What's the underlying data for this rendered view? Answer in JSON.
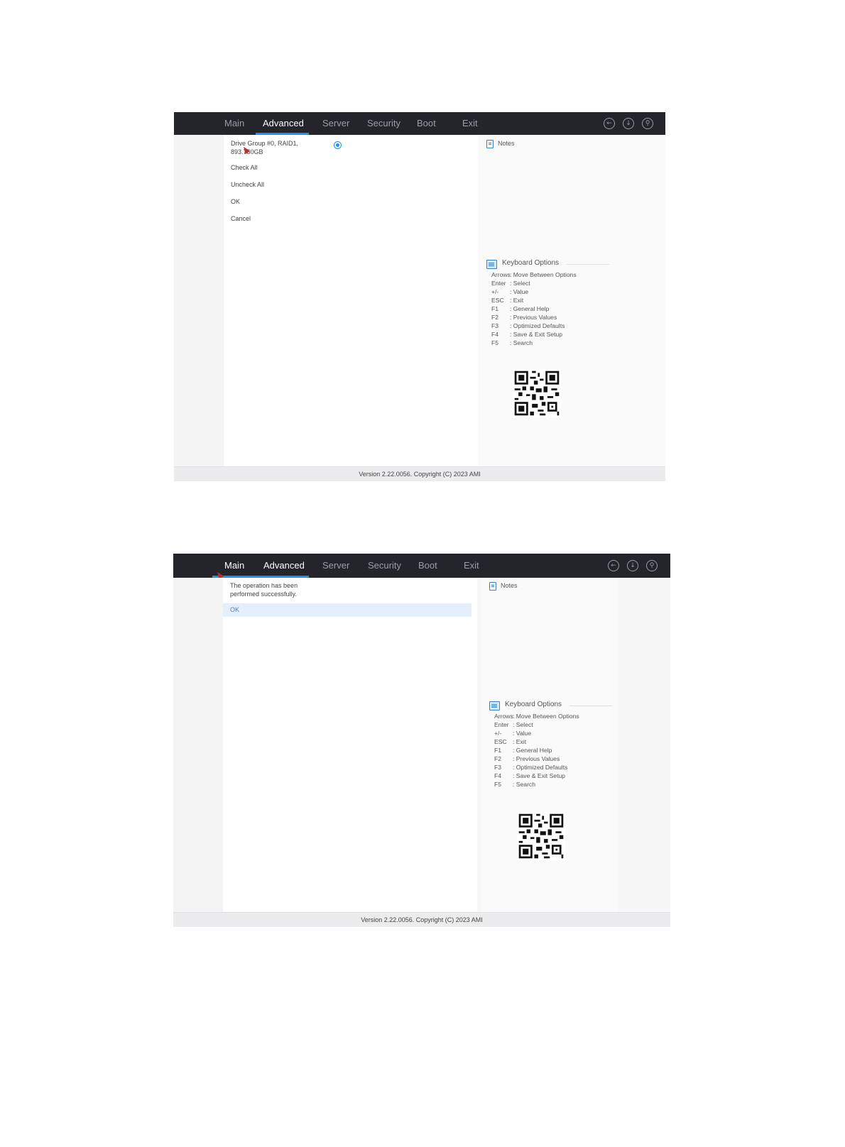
{
  "tabs": [
    "Main",
    "Advanced",
    "Server",
    "Security",
    "Boot",
    "Exit"
  ],
  "toolbar_icons": [
    "back-icon",
    "download-icon",
    "search-icon"
  ],
  "colors": {
    "topbar": "#23252b",
    "accent": "#1f8ef1",
    "ok_highlight": "#e4effb"
  },
  "screen1": {
    "active_tab": "Advanced",
    "items": [
      "Drive Group #0, RAID1,",
      "893.750GB",
      "Check All",
      "Uncheck All",
      "OK",
      "Cancel"
    ],
    "radio_selected": true
  },
  "screen2": {
    "active_tab": "Advanced",
    "message_line1": "The operation has been",
    "message_line2": "performed successfully.",
    "ok_label": "OK"
  },
  "notes_title": "Notes",
  "keyboard": {
    "title": "Keyboard Options",
    "rows": [
      {
        "key": "Arrows",
        "desc": ": Move Between Options"
      },
      {
        "key": "Enter",
        "desc": ": Select"
      },
      {
        "key": "+/-",
        "desc": ": Value"
      },
      {
        "key": "ESC",
        "desc": ": Exit"
      },
      {
        "key": "F1",
        "desc": ": General Help"
      },
      {
        "key": "F2",
        "desc": ": Previous Values"
      },
      {
        "key": "F3",
        "desc": ": Optimized Defaults"
      },
      {
        "key": "F4",
        "desc": ": Save & Exit Setup"
      },
      {
        "key": "F5",
        "desc": ": Search"
      }
    ]
  },
  "footer": "Version 2.22.0056. Copyright (C) 2023 AMI"
}
